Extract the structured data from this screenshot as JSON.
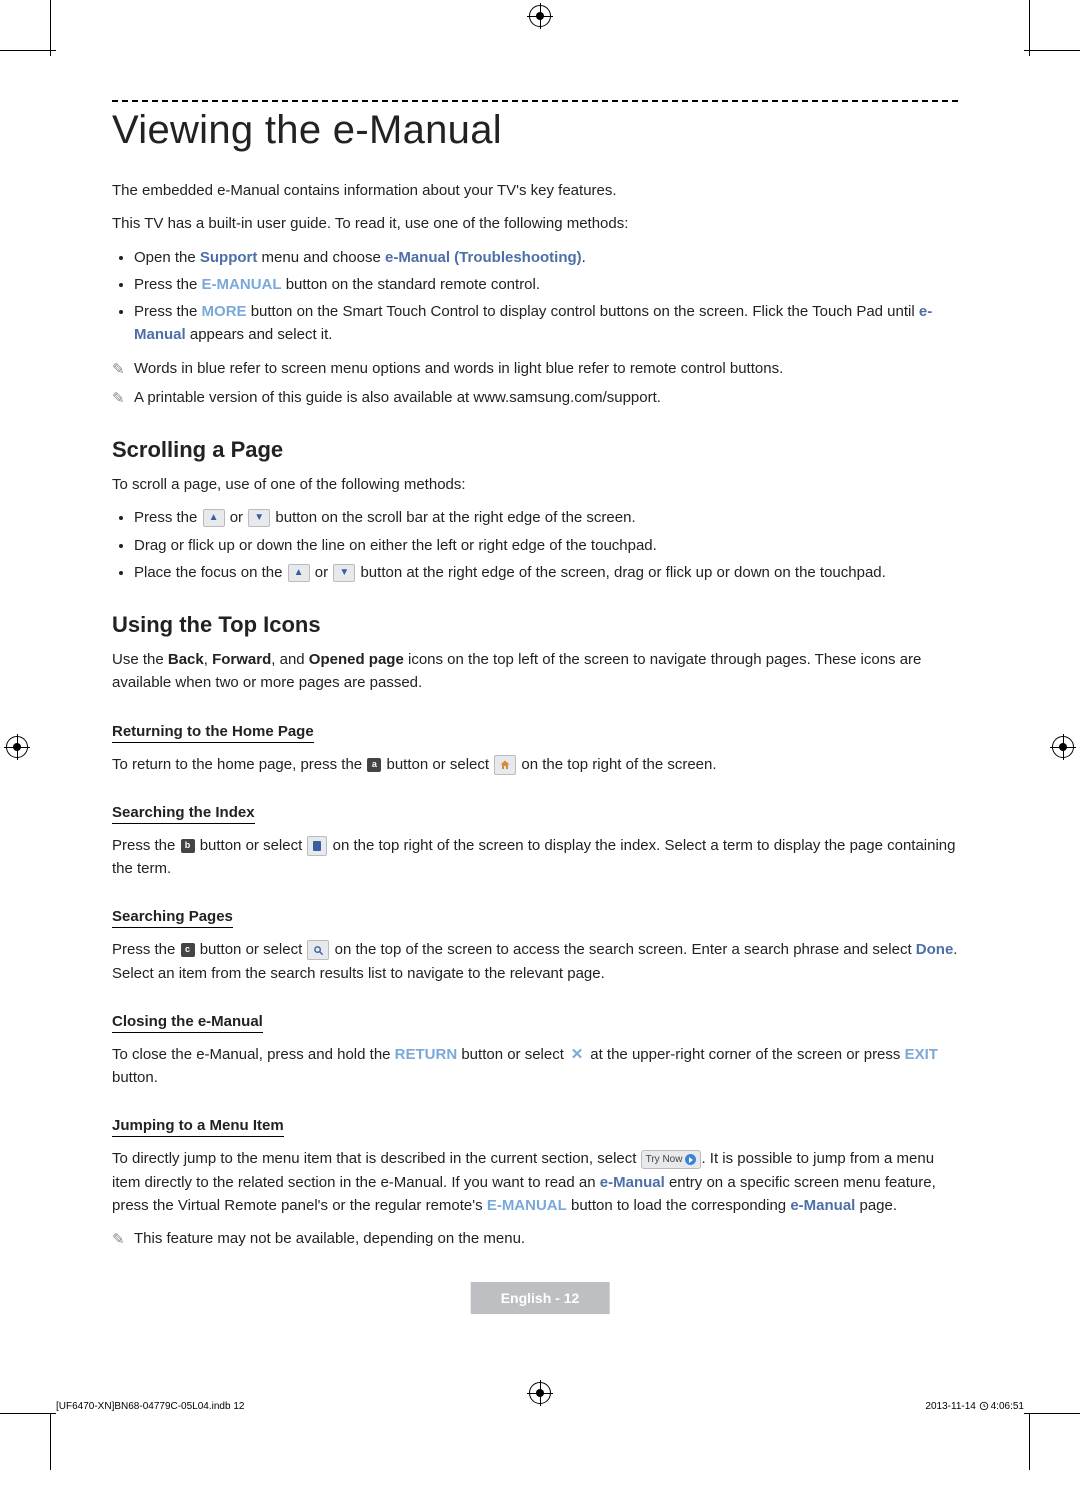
{
  "title": "Viewing the e-Manual",
  "intro1": "The embedded e-Manual contains information about your TV's key features.",
  "intro2": "This TV has a built-in user guide. To read it, use one of the following methods:",
  "bullets1": {
    "b1_a": "Open the ",
    "b1_support": "Support",
    "b1_b": " menu and choose ",
    "b1_emanual": "e-Manual (Troubleshooting)",
    "b1_c": ".",
    "b2_a": "Press the ",
    "b2_btn": "E-MANUAL",
    "b2_b": " button on the standard remote control.",
    "b3_a": "Press the ",
    "b3_more": "MORE",
    "b3_b": " button on the Smart Touch Control to display control buttons on the screen. Flick the Touch Pad until ",
    "b3_em": "e-Manual",
    "b3_c": " appears and select it."
  },
  "note1": "Words in blue refer to screen menu options and words in light blue refer to remote control buttons.",
  "note2": "A printable version of this guide is also available at www.samsung.com/support.",
  "section2": {
    "heading": "Scrolling a Page",
    "lead": "To scroll a page, use of one of the following methods:",
    "b1_a": "Press the ",
    "b1_b": " or ",
    "b1_c": " button on the scroll bar at the right edge of the screen.",
    "b2": "Drag or flick up or down the line on either the left or right edge of the touchpad.",
    "b3_a": "Place the focus on the ",
    "b3_b": " or ",
    "b3_c": " button at the right edge of the screen, drag or flick up or down on the touchpad."
  },
  "section3": {
    "heading": "Using the Top Icons",
    "lead_a": "Use the ",
    "back": "Back",
    "sep1": ", ",
    "fwd": "Forward",
    "sep2": ", and ",
    "opened": "Opened page",
    "lead_b": " icons on the top left of the screen to navigate through pages. These icons are available when two or more pages are passed.",
    "sub1": "Returning to the Home Page",
    "s1_a": "To return to the home page, press the ",
    "s1_alabel": "a",
    "s1_b": " button or select ",
    "s1_c": " on the top right of the screen.",
    "sub2": "Searching the Index",
    "s2_a": "Press the ",
    "s2_blabel": "b",
    "s2_b": " button or select ",
    "s2_c": " on the top right of the screen to display the index. Select a term to display the page containing the term.",
    "sub3": "Searching Pages",
    "s3_a": "Press the ",
    "s3_clabel": "c",
    "s3_b": " button or select ",
    "s3_c": " on the top of the screen to access the search screen. Enter a search phrase and select ",
    "done": "Done",
    "s3_d": ". Select an item from the search results list to navigate to the relevant page.",
    "sub4": "Closing the e-Manual",
    "s4_a": "To close the e-Manual, press and hold the ",
    "return": "RETURN",
    "s4_b": " button or select ",
    "s4_c": " at the upper-right corner of the screen or press ",
    "exit": "EXIT",
    "s4_d": " button.",
    "sub5": "Jumping to a Menu Item",
    "s5_a": "To directly jump to the menu item that is described in the current section, select ",
    "trynow": "Try Now",
    "s5_b": ". It is possible to jump from a menu item directly to the related section in the e-Manual. If you want to read an ",
    "s5_em": "e-Manual",
    "s5_c": " entry on a specific screen menu feature, press the Virtual Remote panel's or the regular remote's ",
    "s5_btn": "E-MANUAL",
    "s5_d": " button to load the corresponding ",
    "s5_em2": "e-Manual",
    "s5_e": " page.",
    "s5_note": "This feature may not be available, depending on the menu."
  },
  "footer": {
    "pagenum": "English - 12",
    "file": "[UF6470-XN]BN68-04779C-05L04.indb   12",
    "date": "2013-11-14   ",
    "time": "4:06:51"
  }
}
